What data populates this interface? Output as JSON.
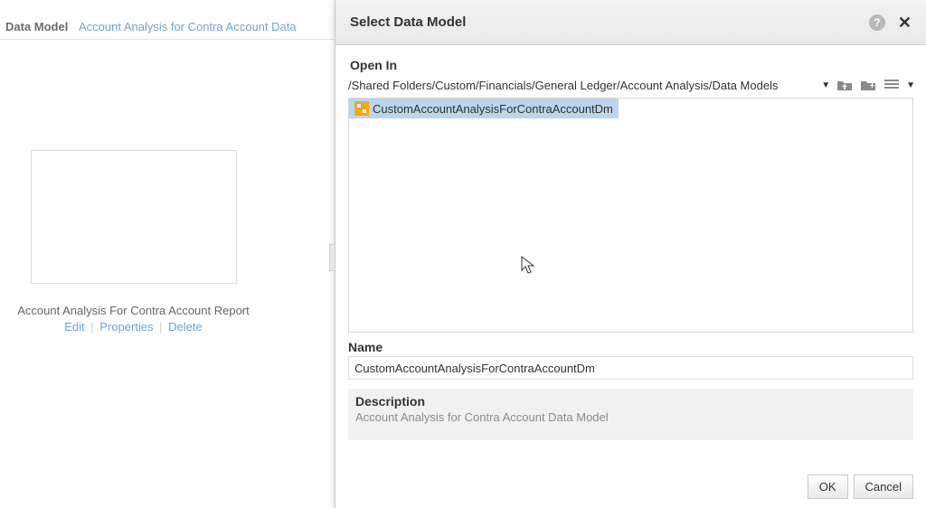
{
  "top_tabs": {
    "data_model_label": "Data Model",
    "report_link": "Account Analysis for Contra Account Data"
  },
  "thumb": {
    "title": "Account Analysis For Contra Account Report",
    "edit": "Edit",
    "properties": "Properties",
    "delete": "Delete"
  },
  "dialog": {
    "title": "Select Data Model",
    "open_in_label": "Open In",
    "path": "/Shared Folders/Custom/Financials/General Ledger/Account Analysis/Data Models",
    "listing_items": [
      {
        "label": "CustomAccountAnalysisForContraAccountDm",
        "selected": true
      }
    ],
    "name_label": "Name",
    "name_value": "CustomAccountAnalysisForContraAccountDm",
    "description_label": "Description",
    "description_value": "Account Analysis for Contra Account Data Model",
    "ok": "OK",
    "cancel": "Cancel"
  }
}
